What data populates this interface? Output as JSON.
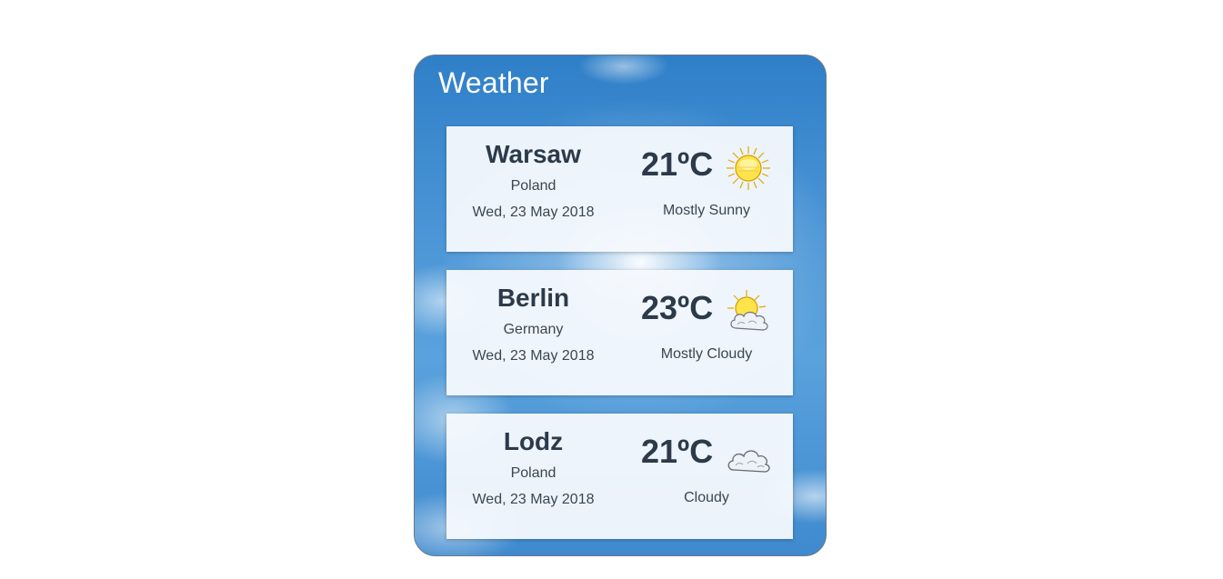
{
  "widget": {
    "title": "Weather"
  },
  "cities": [
    {
      "name": "Warsaw",
      "country": "Poland",
      "date": "Wed, 23 May 2018",
      "temperature": "21ºC",
      "condition": "Mostly Sunny",
      "icon": "sun-icon"
    },
    {
      "name": "Berlin",
      "country": "Germany",
      "date": "Wed, 23 May 2018",
      "temperature": "23ºC",
      "condition": "Mostly Cloudy",
      "icon": "sun-cloud-icon"
    },
    {
      "name": "Lodz",
      "country": "Poland",
      "date": "Wed, 23 May 2018",
      "temperature": "21ºC",
      "condition": "Cloudy",
      "icon": "cloud-icon"
    }
  ],
  "colors": {
    "sky_blue": "#4b95d6",
    "card_background": "#f6f9fd",
    "text_dark": "#2c3a4a",
    "title_text": "#ffffff"
  }
}
